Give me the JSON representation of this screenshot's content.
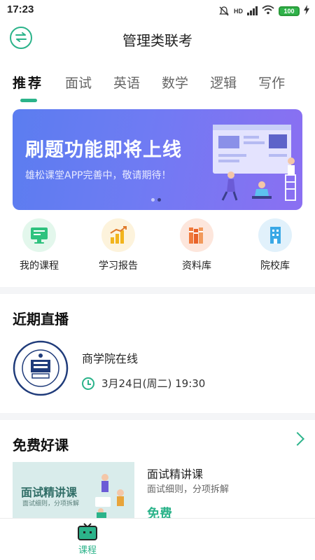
{
  "status_bar": {
    "time": "17:23",
    "network": "HD",
    "battery": "100"
  },
  "header": {
    "title": "管理类联考",
    "swap_icon": "swap-arrows-icon"
  },
  "tabs": [
    {
      "label": "推荐",
      "active": true
    },
    {
      "label": "面试",
      "active": false
    },
    {
      "label": "英语",
      "active": false
    },
    {
      "label": "数学",
      "active": false
    },
    {
      "label": "逻辑",
      "active": false
    },
    {
      "label": "写作",
      "active": false
    }
  ],
  "banner": {
    "title": "刷题功能即将上线",
    "subtitle": "雄松课堂APP完善中，敬请期待！",
    "page_count": 2,
    "active_page": 2
  },
  "quick_entries": [
    {
      "label": "我的课程",
      "icon": "monitor-icon",
      "color": "#2ec27e"
    },
    {
      "label": "学习报告",
      "icon": "bar-chart-icon",
      "color": "#f2b41c"
    },
    {
      "label": "资料库",
      "icon": "books-icon",
      "color": "#f07a3c"
    },
    {
      "label": "院校库",
      "icon": "building-icon",
      "color": "#3aa8e6"
    }
  ],
  "live_section": {
    "title": "近期直播",
    "item": {
      "name": "商学院在线",
      "time": "3月24日(周二) 19:30",
      "logo": "university-seal-logo"
    }
  },
  "free_section": {
    "title": "免费好课",
    "course": {
      "card_title": "面试精讲课",
      "card_sub": "面试细则，分项拆解",
      "name": "面试精讲课",
      "desc": "面试细则，分项拆解",
      "price": "免费"
    }
  },
  "bottom_nav": {
    "items": [
      {
        "label": "课程",
        "icon": "tv-icon",
        "active": true
      }
    ]
  },
  "colors": {
    "accent": "#2bb38a",
    "banner_start": "#5b7df0",
    "banner_end": "#8b6ff2"
  }
}
